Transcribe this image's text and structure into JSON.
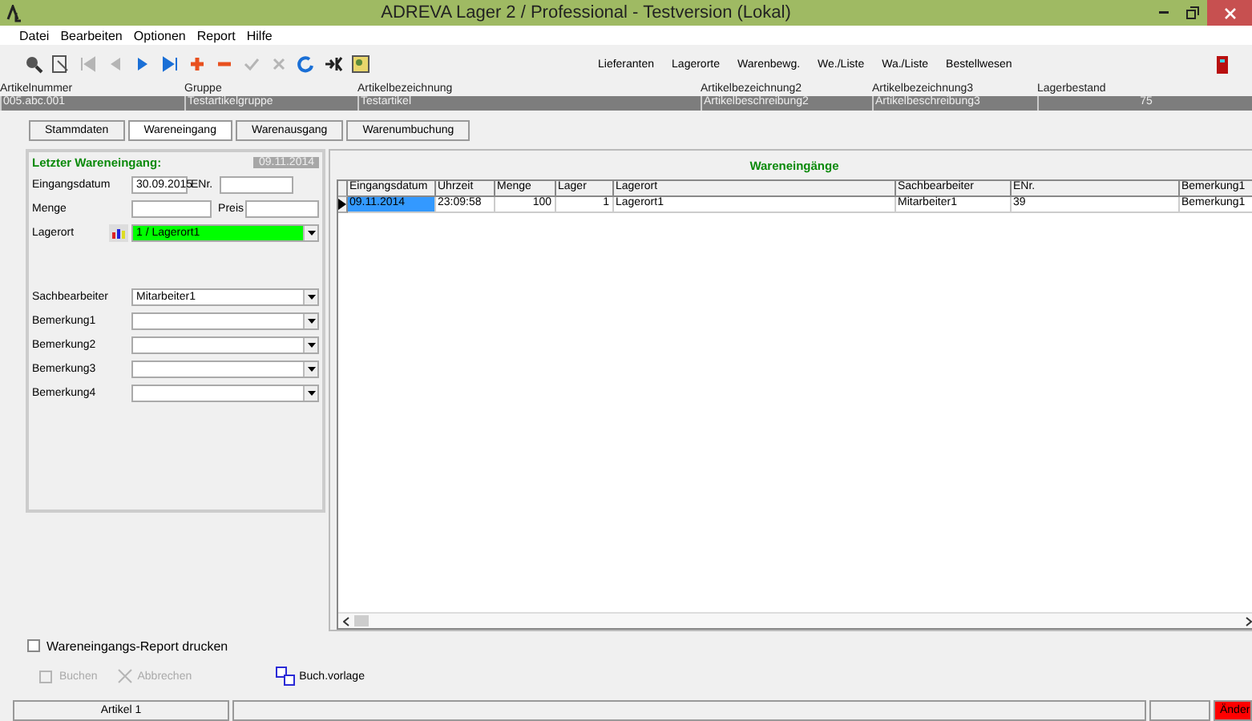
{
  "window": {
    "title": "ADREVA Lager 2 / Professional - Testversion (Lokal)"
  },
  "menu": [
    "Datei",
    "Bearbeiten",
    "Optionen",
    "Report",
    "Hilfe"
  ],
  "tools": [
    {
      "kind": "search",
      "disabled": false
    },
    {
      "kind": "scan",
      "disabled": false
    },
    {
      "kind": "first",
      "disabled": true
    },
    {
      "kind": "prev",
      "disabled": true
    },
    {
      "kind": "next",
      "disabled": false
    },
    {
      "kind": "last",
      "disabled": false
    },
    {
      "kind": "add",
      "disabled": false
    },
    {
      "kind": "remove",
      "disabled": false
    },
    {
      "kind": "check",
      "disabled": true
    },
    {
      "kind": "cancel",
      "disabled": true
    },
    {
      "kind": "refresh",
      "disabled": false
    },
    {
      "kind": "key",
      "disabled": false
    },
    {
      "kind": "picture",
      "disabled": false
    }
  ],
  "nav_links": [
    "Lieferanten",
    "Lagerorte",
    "Warenbewg.",
    "We./Liste",
    "Wa./Liste",
    "Bestellwesen"
  ],
  "article": [
    {
      "label": "Artikelnummer",
      "value": "005.abc.001"
    },
    {
      "label": "Gruppe",
      "value": "Testartikelgruppe"
    },
    {
      "label": "Artikelbezeichnung",
      "value": "Testartikel"
    },
    {
      "label": "Artikelbezeichnung2",
      "value": "Artikelbeschreibung2"
    },
    {
      "label": "Artikelbezeichnung3",
      "value": "Artikelbeschreibung3"
    },
    {
      "label": "Lagerbestand",
      "value": "75"
    }
  ],
  "tabs": [
    {
      "label": "Stammdaten",
      "selected": false
    },
    {
      "label": "Wareneingang",
      "selected": true
    },
    {
      "label": "Warenausgang",
      "selected": false
    },
    {
      "label": "Warenumbuchung",
      "selected": false
    }
  ],
  "form": {
    "heading": "Letzter Wareneingang:",
    "last_date": "09.11.2014",
    "eingangsdatum": {
      "label": "Eingangsdatum",
      "value": "30.09.2015"
    },
    "enr": {
      "label": "ENr."
    },
    "menge": {
      "label": "Menge"
    },
    "preis": {
      "label": "Preis"
    },
    "lagerort": {
      "label": "Lagerort",
      "value": "1 / Lagerort1"
    },
    "combos": [
      {
        "label": "Sachbearbeiter",
        "value": "Mitarbeiter1"
      },
      {
        "label": "Bemerkung1"
      },
      {
        "label": "Bemerkung2"
      },
      {
        "label": "Bemerkung3"
      },
      {
        "label": "Bemerkung4"
      }
    ]
  },
  "grid": {
    "title": "Wareneingänge",
    "columns": [
      "Eingangsdatum",
      "Uhrzeit",
      "Menge",
      "Lager",
      "Lagerort",
      "Sachbearbeiter",
      "ENr.",
      "Bemerkung1"
    ],
    "rows": [
      {
        "selected": true,
        "cells": [
          "09.11.2014",
          "23:09:58",
          "100",
          "1",
          "Lagerort1",
          "Mitarbeiter1",
          "39",
          "Bemerkung1"
        ]
      }
    ]
  },
  "report_checkbox": {
    "label": "Wareneingangs-Report drucken",
    "checked": false
  },
  "actions": [
    {
      "kind": "book",
      "label": "Buchen",
      "disabled": true
    },
    {
      "kind": "cancel",
      "label": "Abbrechen",
      "disabled": true
    },
    {
      "kind": "template",
      "label": "Buch.vorlage",
      "disabled": false
    }
  ],
  "status_bar": {
    "item": "Artikel 1",
    "mode": "Änder"
  }
}
